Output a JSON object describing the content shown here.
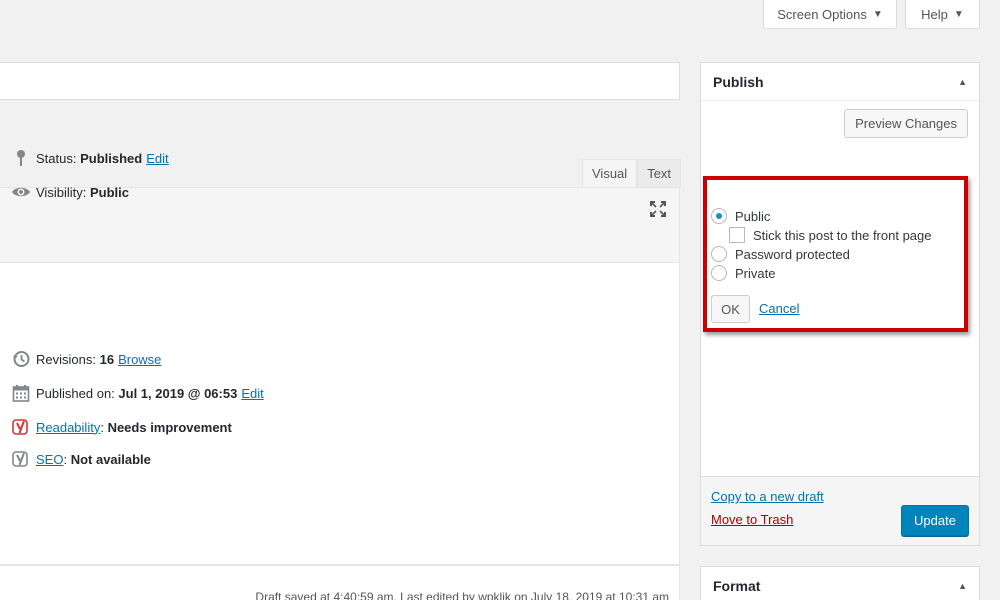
{
  "header": {
    "screen_options_label": "Screen Options",
    "help_label": "Help"
  },
  "editor": {
    "tab_visual": "Visual",
    "tab_text": "Text",
    "status_text": "Draft saved at 4:40:59 am. Last edited by wpklik on July 18, 2019 at 10:31 am"
  },
  "publish": {
    "title": "Publish",
    "preview_label": "Preview Changes",
    "status_label": "Status:",
    "status_value": "Published",
    "status_edit": "Edit",
    "visibility_label": "Visibility:",
    "visibility_value": "Public",
    "options": {
      "public": "Public",
      "sticky": "Stick this post to the front page",
      "password": "Password protected",
      "private": "Private"
    },
    "ok_label": "OK",
    "cancel_label": "Cancel",
    "revisions_label": "Revisions:",
    "revisions_value": "16",
    "revisions_browse": "Browse",
    "published_label": "Published on:",
    "published_value": "Jul 1, 2019 @ 06:53",
    "published_edit": "Edit",
    "readability_link": "Readability",
    "readability_value": "Needs improvement",
    "seo_link": "SEO",
    "seo_value": "Not available",
    "copy_draft": "Copy to a new draft",
    "trash": "Move to Trash",
    "update_label": "Update"
  },
  "format": {
    "title": "Format"
  },
  "colors": {
    "primary": "#0085ba",
    "link": "#0073aa",
    "highlight": "#cc0000",
    "trash": "#aa0000"
  }
}
